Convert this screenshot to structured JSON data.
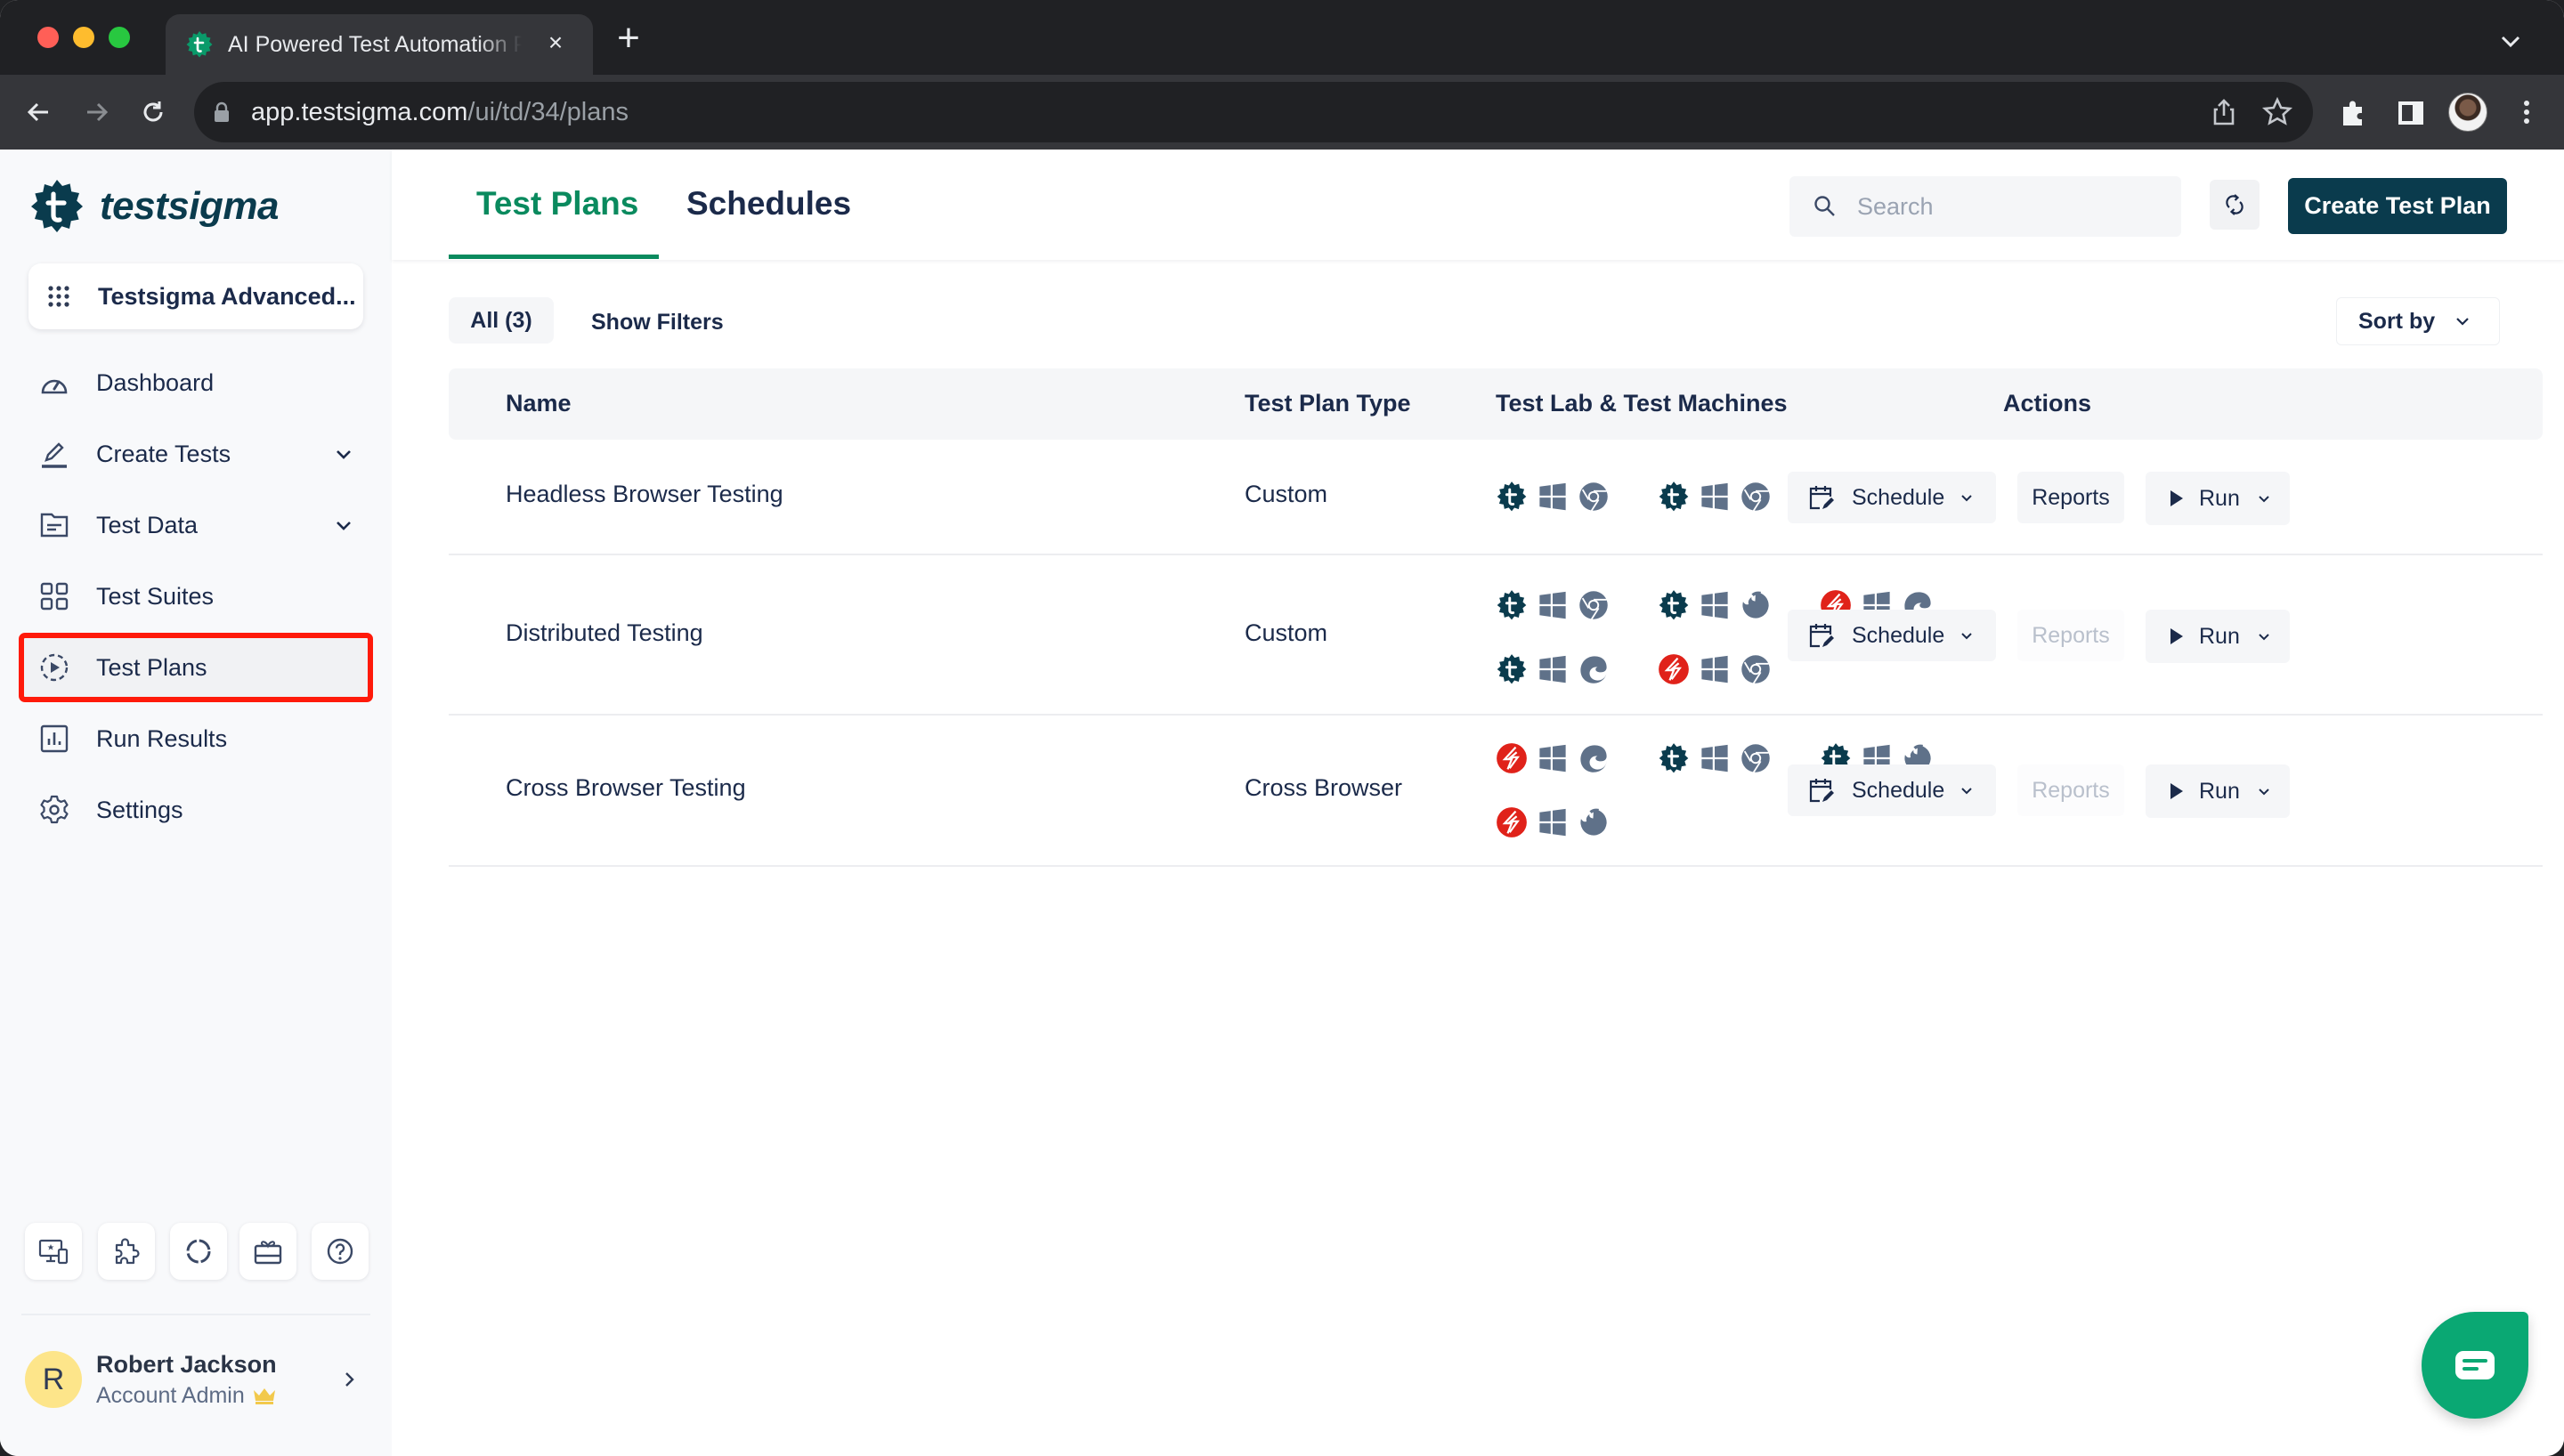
{
  "browser": {
    "tab_title": "AI Powered Test Automation Platform",
    "tab_close": "×",
    "new_tab": "+",
    "url_host": "app.testsigma.com",
    "url_path": "/ui/td/34/plans"
  },
  "sidebar": {
    "brand": "testsigma",
    "workspace": "Testsigma Advanced...",
    "items": [
      {
        "label": "Dashboard",
        "icon": "dashboard-gauge-icon"
      },
      {
        "label": "Create Tests",
        "icon": "pencil-icon",
        "expandable": true
      },
      {
        "label": "Test Data",
        "icon": "folder-icon",
        "expandable": true
      },
      {
        "label": "Test Suites",
        "icon": "grid-icon"
      },
      {
        "label": "Test Plans",
        "icon": "play-circle-icon",
        "active": true
      },
      {
        "label": "Run Results",
        "icon": "bar-chart-icon"
      },
      {
        "label": "Settings",
        "icon": "gear-icon"
      }
    ],
    "utilities": [
      "devices-icon",
      "puzzle-icon",
      "loading-circle-icon",
      "gift-icon",
      "help-icon"
    ],
    "user": {
      "initial": "R",
      "name": "Robert Jackson",
      "role": "Account Admin"
    }
  },
  "header": {
    "tabs": [
      {
        "label": "Test Plans",
        "active": true
      },
      {
        "label": "Schedules",
        "active": false
      }
    ],
    "search_placeholder": "Search",
    "create_button": "Create Test Plan"
  },
  "filters": {
    "all_label": "All (3)",
    "show_filters": "Show Filters",
    "sort_by": "Sort by"
  },
  "table": {
    "columns": [
      "Name",
      "Test Plan Type",
      "Test Lab & Test Machines",
      "Actions"
    ],
    "rows": [
      {
        "name": "Headless Browser Testing",
        "type": "Custom",
        "machines": [
          {
            "lab": "testsigma",
            "os": "windows",
            "browser": "chrome"
          },
          {
            "lab": "testsigma",
            "os": "windows",
            "browser": "chrome"
          }
        ],
        "reports_enabled": true
      },
      {
        "name": "Distributed Testing",
        "type": "Custom",
        "machines": [
          {
            "lab": "testsigma",
            "os": "windows",
            "browser": "chrome"
          },
          {
            "lab": "testsigma",
            "os": "windows",
            "browser": "firefox"
          },
          {
            "lab": "lambdatest",
            "os": "windows",
            "browser": "edge"
          },
          {
            "lab": "testsigma",
            "os": "windows",
            "browser": "edge"
          },
          {
            "lab": "lambdatest",
            "os": "windows",
            "browser": "chrome"
          }
        ],
        "reports_enabled": false
      },
      {
        "name": "Cross Browser Testing",
        "type": "Cross Browser",
        "machines": [
          {
            "lab": "lambdatest",
            "os": "windows",
            "browser": "edge"
          },
          {
            "lab": "testsigma",
            "os": "windows",
            "browser": "chrome"
          },
          {
            "lab": "testsigma",
            "os": "windows",
            "browser": "firefox"
          },
          {
            "lab": "lambdatest",
            "os": "windows",
            "browser": "firefox"
          }
        ],
        "reports_enabled": false
      }
    ],
    "actions": {
      "schedule": "Schedule",
      "reports": "Reports",
      "run": "Run"
    }
  },
  "colors": {
    "brand_dark": "#0a3b4d",
    "accent_green": "#0a8a5e",
    "chat_green": "#0aa873",
    "highlight_red": "#ff1a0a",
    "lab_red": "#e0221a",
    "icon_gray": "#5f7189"
  }
}
